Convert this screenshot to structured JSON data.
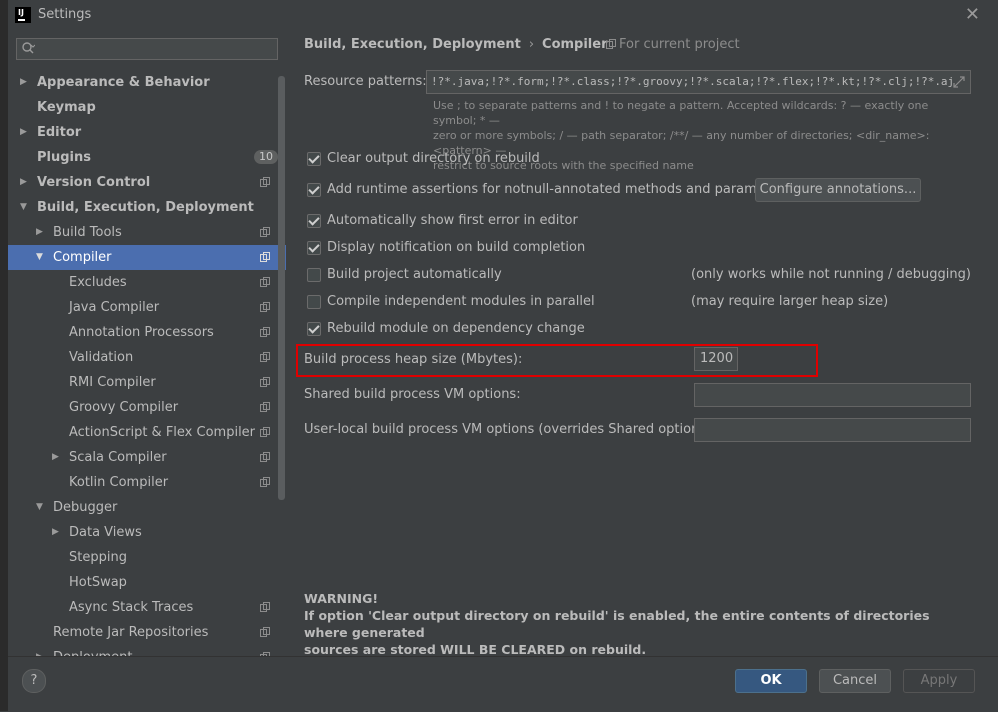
{
  "window": {
    "title": "Settings",
    "close_label": "✕",
    "app_icon_label": "IJ"
  },
  "search": {
    "placeholder": ""
  },
  "sidebar": {
    "items": [
      {
        "label": "Appearance & Behavior",
        "arrow": "▶",
        "bold": true,
        "copy": false
      },
      {
        "label": "Keymap",
        "arrow": "",
        "bold": true,
        "copy": false
      },
      {
        "label": "Editor",
        "arrow": "▶",
        "bold": true,
        "copy": false
      },
      {
        "label": "Plugins",
        "arrow": "",
        "bold": true,
        "copy": false,
        "badge": "10"
      },
      {
        "label": "Version Control",
        "arrow": "▶",
        "bold": true,
        "copy": true
      },
      {
        "label": "Build, Execution, Deployment",
        "arrow": "▼",
        "bold": true,
        "copy": false
      },
      {
        "label": "Build Tools",
        "arrow": "▶",
        "bold": false,
        "copy": true
      },
      {
        "label": "Compiler",
        "arrow": "▼",
        "bold": false,
        "copy": true,
        "selected": true
      },
      {
        "label": "Excludes",
        "arrow": "",
        "bold": false,
        "copy": true
      },
      {
        "label": "Java Compiler",
        "arrow": "",
        "bold": false,
        "copy": true
      },
      {
        "label": "Annotation Processors",
        "arrow": "",
        "bold": false,
        "copy": true
      },
      {
        "label": "Validation",
        "arrow": "",
        "bold": false,
        "copy": true
      },
      {
        "label": "RMI Compiler",
        "arrow": "",
        "bold": false,
        "copy": true
      },
      {
        "label": "Groovy Compiler",
        "arrow": "",
        "bold": false,
        "copy": true
      },
      {
        "label": "ActionScript & Flex Compiler",
        "arrow": "",
        "bold": false,
        "copy": true
      },
      {
        "label": "Scala Compiler",
        "arrow": "▶",
        "bold": false,
        "copy": true
      },
      {
        "label": "Kotlin Compiler",
        "arrow": "",
        "bold": false,
        "copy": true
      },
      {
        "label": "Debugger",
        "arrow": "▼",
        "bold": false,
        "copy": false
      },
      {
        "label": "Data Views",
        "arrow": "▶",
        "bold": false,
        "copy": false
      },
      {
        "label": "Stepping",
        "arrow": "",
        "bold": false,
        "copy": false
      },
      {
        "label": "HotSwap",
        "arrow": "",
        "bold": false,
        "copy": false
      },
      {
        "label": "Async Stack Traces",
        "arrow": "",
        "bold": false,
        "copy": true
      },
      {
        "label": "Remote Jar Repositories",
        "arrow": "",
        "bold": false,
        "copy": true
      },
      {
        "label": "Deployment",
        "arrow": "▶",
        "bold": false,
        "copy": true
      }
    ]
  },
  "breadcrumb": {
    "part1": "Build, Execution, Deployment",
    "sep": "›",
    "part2": "Compiler"
  },
  "scope": {
    "label": "For current project"
  },
  "resource": {
    "label": "Resource patterns:",
    "value": "!?*.java;!?*.form;!?*.class;!?*.groovy;!?*.scala;!?*.flex;!?*.kt;!?*.clj;!?*.aj",
    "hint_line1": "Use ; to separate patterns and ! to negate a pattern. Accepted wildcards: ? — exactly one symbol; * —",
    "hint_line2": "zero or more symbols; / — path separator; /**/ — any number of directories; <dir_name>:<pattern> —",
    "hint_line3": "restrict to source roots with the specified name"
  },
  "options": {
    "clear_output": {
      "label": "Clear output directory on rebuild",
      "checked": true
    },
    "runtime_assertions": {
      "label": "Add runtime assertions for notnull-annotated methods and parameters",
      "checked": true
    },
    "configure_annotations": "Configure annotations...",
    "show_first_error": {
      "label": "Automatically show first error in editor",
      "checked": true
    },
    "notify_completion": {
      "label": "Display notification on build completion",
      "checked": true
    },
    "build_auto": {
      "label": "Build project automatically",
      "checked": false,
      "note": "(only works while not running / debugging)"
    },
    "compile_parallel": {
      "label": "Compile independent modules in parallel",
      "checked": false,
      "note": "(may require larger heap size)"
    },
    "rebuild_on_change": {
      "label": "Rebuild module on dependency change",
      "checked": true
    }
  },
  "heap": {
    "label": "Build process heap size (Mbytes):",
    "value": "1200"
  },
  "shared_vm": {
    "label": "Shared build process VM options:",
    "value": ""
  },
  "user_vm": {
    "label": "User-local build process VM options (overrides Shared options):",
    "value": ""
  },
  "warning": {
    "title": "WARNING!",
    "line1": "If option 'Clear output directory on rebuild' is enabled, the entire contents of directories where generated",
    "line2": "sources are stored WILL BE CLEARED on rebuild."
  },
  "footer": {
    "help": "?",
    "ok": "OK",
    "cancel": "Cancel",
    "apply": "Apply"
  },
  "colors": {
    "background": "#3c3f41",
    "selection": "#4b6eaf",
    "primary_button": "#365880",
    "highlight_box": "#e00000"
  }
}
